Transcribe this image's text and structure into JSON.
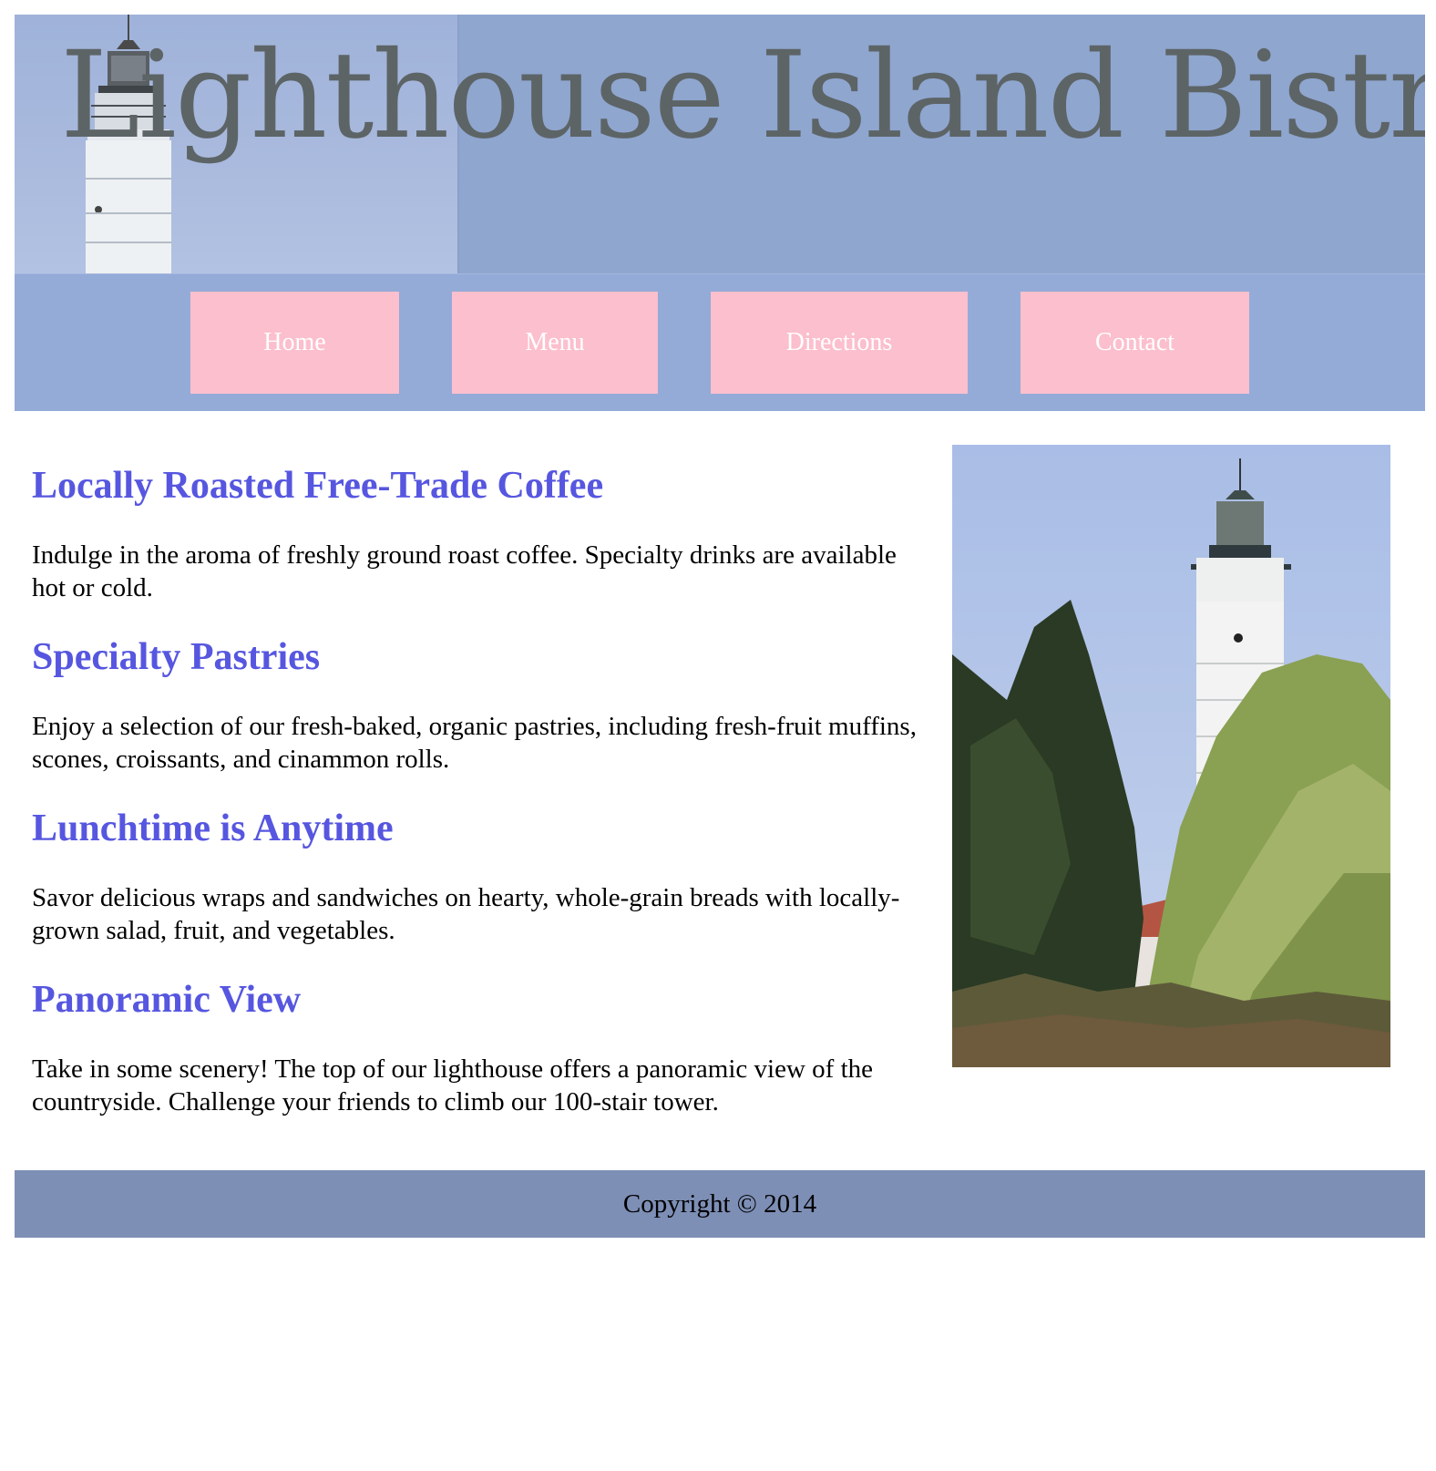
{
  "header": {
    "title": "Lighthouse Island Bistro"
  },
  "nav": {
    "items": [
      {
        "label": "Home"
      },
      {
        "label": "Menu"
      },
      {
        "label": "Directions"
      },
      {
        "label": "Contact"
      }
    ]
  },
  "sections": [
    {
      "heading": "Locally Roasted Free-Trade Coffee",
      "text": "Indulge in the aroma of freshly ground roast coffee. Specialty drinks are available hot or cold."
    },
    {
      "heading": "Specialty Pastries",
      "text": "Enjoy a selection of our fresh-baked, organic pastries, including fresh-fruit muffins, scones, croissants, and cinammon rolls."
    },
    {
      "heading": "Lunchtime is Anytime",
      "text": "Savor delicious wraps and sandwiches on hearty, whole-grain breads with locally-grown salad, fruit, and vegetables."
    },
    {
      "heading": "Panoramic View",
      "text": "Take in some scenery! The top of our lighthouse offers a panoramic view of the countryside. Challenge your friends to climb our 100-stair tower."
    }
  ],
  "footer": {
    "copyright": "Copyright © 2014"
  },
  "colors": {
    "header_bg": "#8fa6cf",
    "nav_bg": "#94abd8",
    "nav_button": "#fcbfcd",
    "heading": "#5656e0",
    "footer_bg": "#7e8fb6"
  }
}
